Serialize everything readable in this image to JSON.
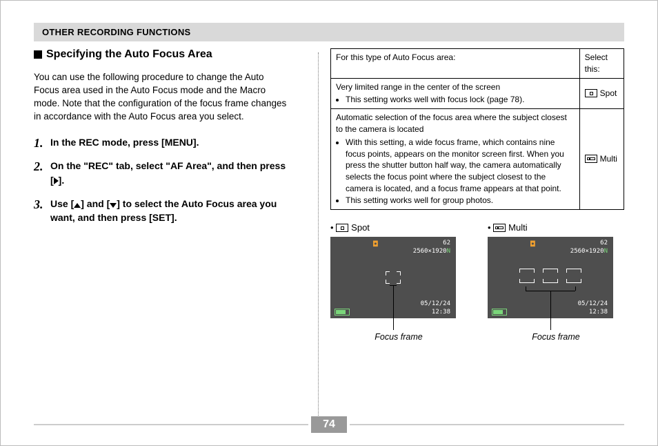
{
  "header": "OTHER RECORDING FUNCTIONS",
  "section_title": "Specifying the Auto Focus Area",
  "intro": "You can use the following procedure to change the Auto Focus area used in the Auto Focus mode and the Macro mode. Note that the configuration of the focus frame changes in accordance with the Auto Focus area you select.",
  "steps": {
    "s1": "In the REC mode, press [MENU].",
    "s2_a": "On the \"REC\" tab, select \"AF Area\", and then press [",
    "s2_b": "].",
    "s3_a": "Use [",
    "s3_b": "] and [",
    "s3_c": "] to select the Auto Focus area you want, and then press [SET]."
  },
  "table": {
    "h1": "For this type of Auto Focus area:",
    "h2": "Select this:",
    "r1": {
      "desc": "Very limited range in the center of the screen",
      "b1": "This setting works well with focus lock (page 78).",
      "sel": "Spot"
    },
    "r2": {
      "desc": "Automatic selection of the focus area where the subject closest to the camera is located",
      "b1": "With this setting, a wide focus frame, which contains nine focus points, appears on the monitor screen first. When you press the shutter button half way, the camera automatically selects the focus point where the subject closest to the camera is located, and a focus frame appears at that point.",
      "b2": "This setting works well for group photos.",
      "sel": "Multi"
    }
  },
  "previews": {
    "spot": "Spot",
    "multi": "Multi",
    "shots": "62",
    "res": "2560",
    "res2": "1920",
    "n": "N",
    "date": "05/12/24",
    "time": "12:38"
  },
  "focus_frame": "Focus frame",
  "page_no": "74"
}
